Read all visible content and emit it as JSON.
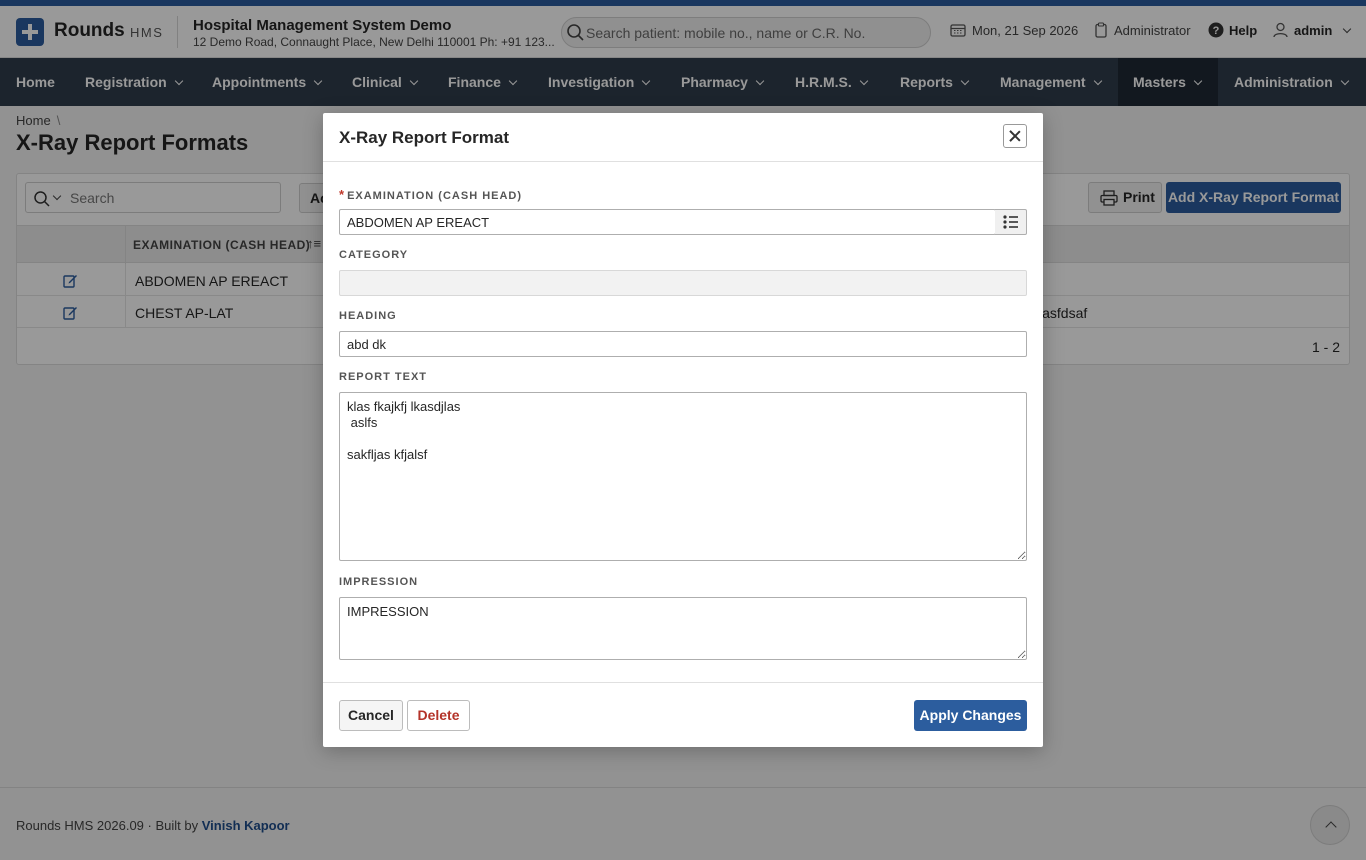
{
  "header": {
    "brand": "Rounds",
    "brand_sub": "HMS",
    "org_name": "Hospital Management System Demo",
    "org_address": "12 Demo Road, Connaught Place, New Delhi 110001 Ph: +91 123...",
    "search_placeholder": "Search patient: mobile no., name or C.R. No.",
    "date": "Mon, 21 Sep 2026",
    "role": "Administrator",
    "help": "Help",
    "user": "admin"
  },
  "nav": {
    "items": [
      {
        "label": "Home",
        "has_menu": false
      },
      {
        "label": "Registration",
        "has_menu": true
      },
      {
        "label": "Appointments",
        "has_menu": true
      },
      {
        "label": "Clinical",
        "has_menu": true
      },
      {
        "label": "Finance",
        "has_menu": true
      },
      {
        "label": "Investigation",
        "has_menu": true
      },
      {
        "label": "Pharmacy",
        "has_menu": true
      },
      {
        "label": "H.R.M.S.",
        "has_menu": true
      },
      {
        "label": "Reports",
        "has_menu": true
      },
      {
        "label": "Management",
        "has_menu": true
      },
      {
        "label": "Masters",
        "has_menu": true,
        "active": true
      },
      {
        "label": "Administration",
        "has_menu": true
      }
    ]
  },
  "page": {
    "breadcrumb": "Home",
    "title": "X-Ray Report Formats",
    "toolbar": {
      "search_placeholder": "Search",
      "actions_label": "Ac",
      "print_label": "Print",
      "add_label": "Add X-Ray Report Format"
    },
    "table": {
      "column_header": "EXAMINATION (CASH HEAD)",
      "rows": [
        {
          "examination": "ABDOMEN AP EREACT",
          "extra": ""
        },
        {
          "examination": "CHEST AP-LAT",
          "extra": "lasfdsaf"
        }
      ],
      "pagination": "1 - 2"
    }
  },
  "footer": {
    "text": "Rounds HMS 2026.09 · Built by",
    "author": "Vinish Kapoor"
  },
  "dialog": {
    "title": "X-Ray Report Format",
    "fields": {
      "examination_label": "EXAMINATION (CASH HEAD)",
      "examination_value": "ABDOMEN AP EREACT",
      "category_label": "CATEGORY",
      "category_value": "",
      "heading_label": "HEADING",
      "heading_value": "abd dk",
      "report_text_label": "REPORT TEXT",
      "report_text_value": "klas fkajkfj lkasdjlas\n aslfs\n\nsakfljas kfjalsf",
      "impression_label": "IMPRESSION",
      "impression_value": "IMPRESSION"
    },
    "buttons": {
      "cancel": "Cancel",
      "delete": "Delete",
      "apply": "Apply Changes"
    }
  },
  "colors": {
    "primary": "#2c5d9e",
    "nav_bg": "#303d4c",
    "nav_active": "#1f2935",
    "danger": "#b43329"
  }
}
